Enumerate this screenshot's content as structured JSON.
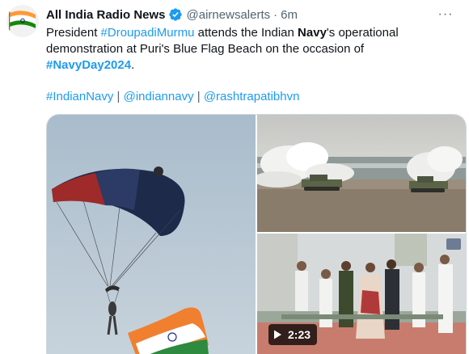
{
  "tweet": {
    "author_name": "All India Radio News",
    "handle": "@airnewsalerts",
    "separator": "·",
    "time": "6m",
    "more_label": "···",
    "text": {
      "p1": "President ",
      "p2": "#DroupadiMurmu",
      "p3": " attends the Indian ",
      "p4": "Navy",
      "p5": "'s operational demonstration at Puri's Blue Flag Beach on the occasion of ",
      "p6": "#NavyDay2024",
      "p7": "."
    },
    "links": {
      "l1": "#IndianNavy",
      "sep1": " | ",
      "l2": "@indiannavy",
      "sep2": " | ",
      "l3": "@rashtrapatibhvn"
    }
  },
  "media": {
    "video_duration": "2:23",
    "icons": {
      "verified": "verified-badge-icon",
      "play": "play-icon",
      "more": "more-icon"
    }
  },
  "colors": {
    "link": "#1d9bf0",
    "muted": "#536471",
    "text": "#0f1419"
  }
}
